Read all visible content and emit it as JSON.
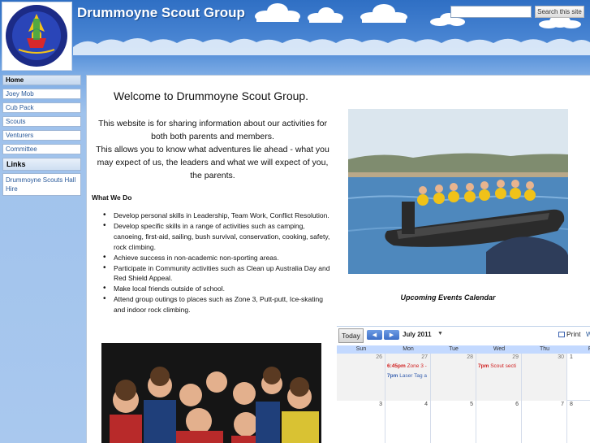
{
  "header": {
    "site_title": "Drummoyne Scout Group",
    "logo": {
      "top_text": "DRUMMOYNE",
      "bottom_text": "90 YEARS 1921"
    },
    "search": {
      "placeholder": "",
      "button_label": "Search this site"
    }
  },
  "sidebar": {
    "nav": [
      {
        "label": "Home",
        "active": true
      },
      {
        "label": "Joey Mob",
        "active": false
      },
      {
        "label": "Cub Pack",
        "active": false
      },
      {
        "label": "Scouts",
        "active": false
      },
      {
        "label": "Venturers",
        "active": false
      },
      {
        "label": "Committee",
        "active": false
      }
    ],
    "links_heading": "Links",
    "links": [
      "Drummoyne Scouts Hall Hire"
    ]
  },
  "main": {
    "welcome": "Welcome to Drummoyne Scout Group.",
    "intro_1": "This website is for sharing information about our activities for both both parents and members.",
    "intro_2": "This allows you to know what adventures lie ahead - what you may expect of us, the leaders and what we will expect of you, the parents.",
    "what_we_do_heading": "What We Do",
    "bullets": [
      "Develop personal skills in Leadership, Team Work, Conflict Resolution.",
      "Develop specific skills in a range of activities such as camping, canoeing, first-aid, sailing, bush survival, conservation, cooking, safety, rock climbing.",
      "Achieve success in non-academic non-sporting areas.",
      " Participate in Community activities such as Clean up Australia Day and Red Shield Appeal.",
      " Make local friends outside of school.",
      "Attend group outings to places such as Zone 3, Putt-putt, Ice-skating and indoor rock climbing."
    ],
    "events_title": "Upcoming Events Calendar"
  },
  "calendar": {
    "today_label": "Today",
    "month_label": "July 2011",
    "print_label": "Print",
    "clipped_label": "W",
    "day_headers": [
      "Sun",
      "Mon",
      "Tue",
      "Wed",
      "Thu",
      "F"
    ],
    "week1": [
      "26",
      "27",
      "28",
      "29",
      "30",
      "1"
    ],
    "week2": [
      "3",
      "4",
      "5",
      "6",
      "7",
      "8"
    ],
    "events": [
      {
        "time": "6:45pm",
        "title": "Zone 3 -",
        "color": "#d01e1e"
      },
      {
        "time": "7pm",
        "title": "Laser Tag a",
        "color": "#3a62b0"
      },
      {
        "time": "7pm",
        "title": "Scout secti",
        "color": "#d01e1e"
      }
    ]
  },
  "colors": {
    "sky_top": "#2f6fc4",
    "sky_bottom": "#a9c8ee",
    "nav_text": "#2a5a9a",
    "calendar_header": "#c3d9ff",
    "event_red": "#d01e1e",
    "event_blue": "#3a62b0"
  }
}
